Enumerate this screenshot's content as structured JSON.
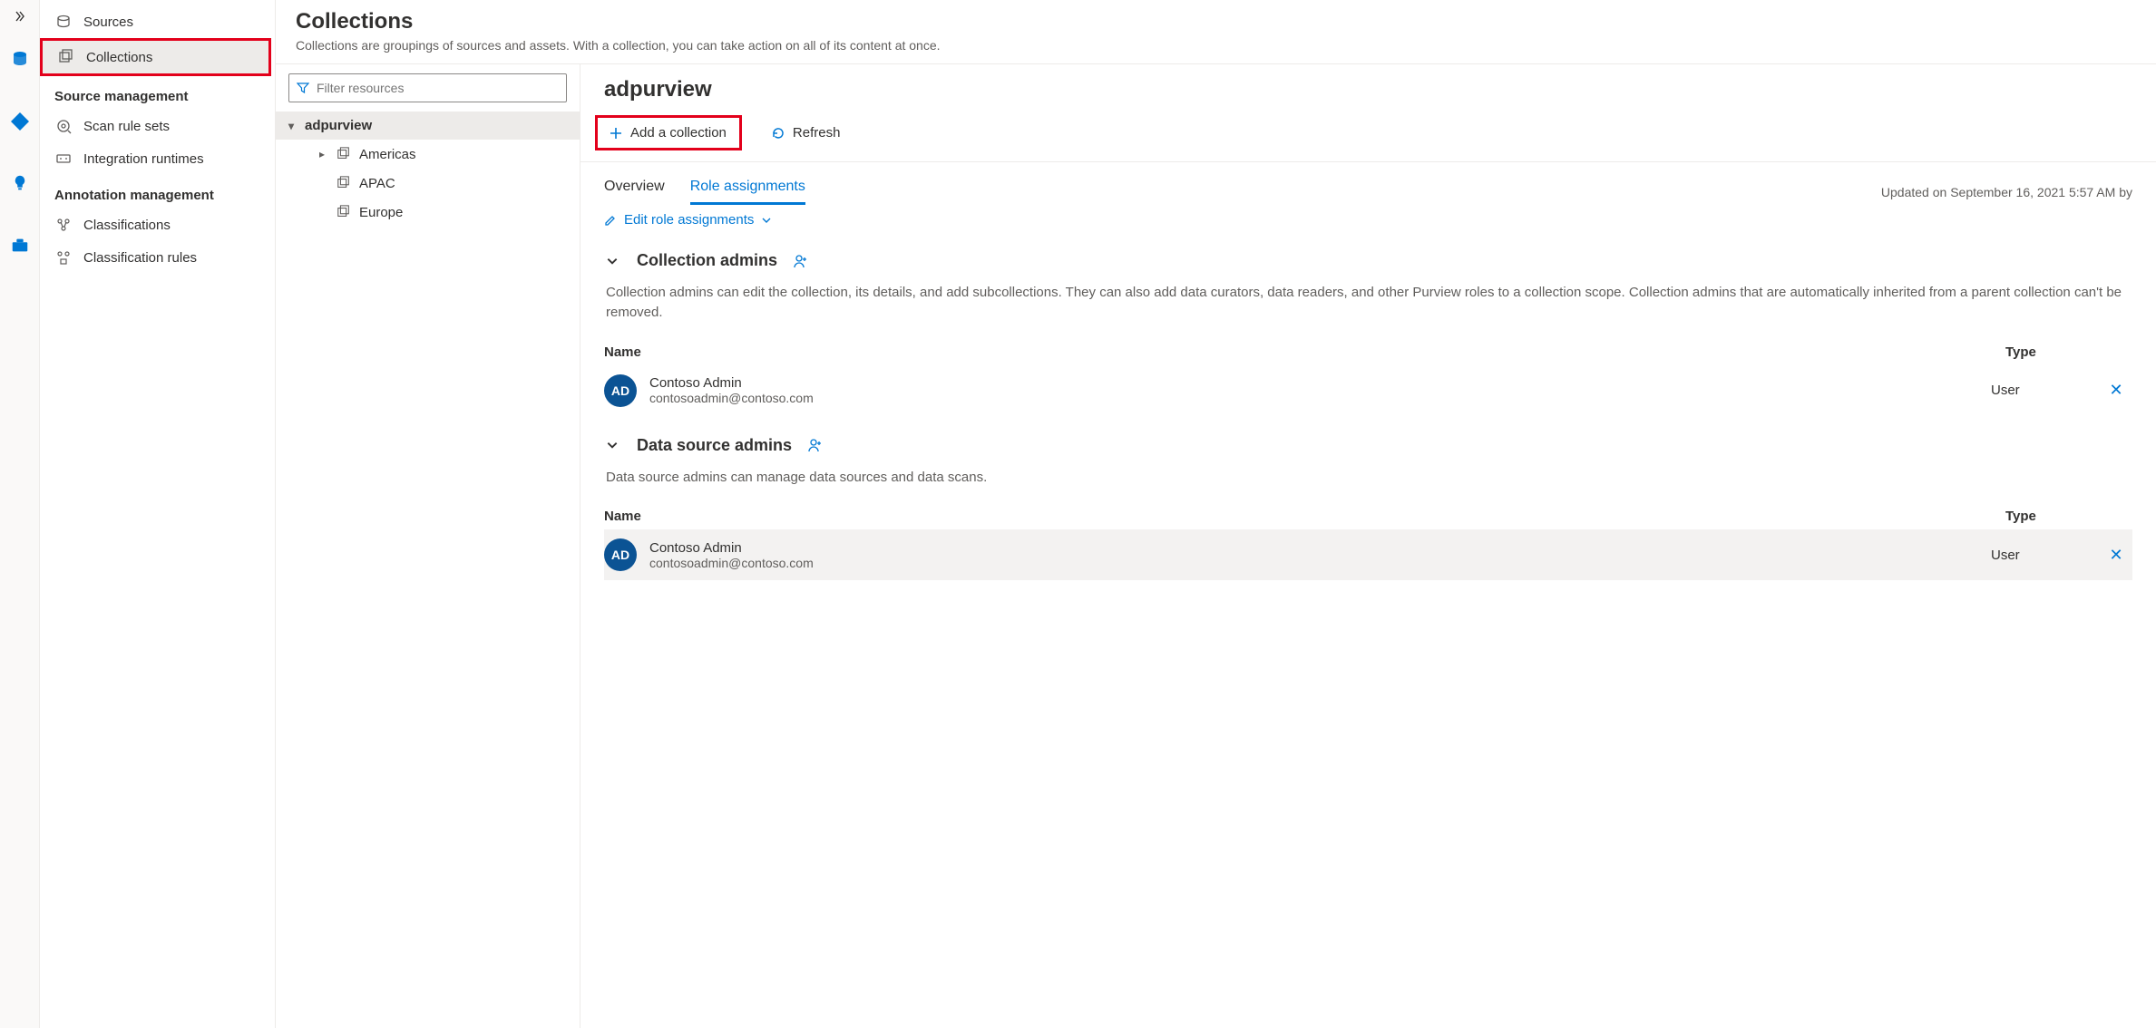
{
  "rail": {
    "icons": [
      "database",
      "flow",
      "insight",
      "toolbox"
    ]
  },
  "leftnav": {
    "items": [
      {
        "icon": "sources",
        "label": "Sources"
      },
      {
        "icon": "collections",
        "label": "Collections"
      }
    ],
    "section1": "Source management",
    "sm_items": [
      {
        "icon": "scanrules",
        "label": "Scan rule sets"
      },
      {
        "icon": "runtimes",
        "label": "Integration runtimes"
      }
    ],
    "section2": "Annotation management",
    "am_items": [
      {
        "icon": "class",
        "label": "Classifications"
      },
      {
        "icon": "classrules",
        "label": "Classification rules"
      }
    ]
  },
  "page": {
    "title": "Collections",
    "subtitle": "Collections are groupings of sources and assets. With a collection, you can take action on all of its content at once."
  },
  "filter": {
    "placeholder": "Filter resources"
  },
  "tree": {
    "root": "adpurview",
    "children": [
      "Americas",
      "APAC",
      "Europe"
    ]
  },
  "detail": {
    "title": "adpurview",
    "addLabel": "Add a collection",
    "refreshLabel": "Refresh",
    "tabs": {
      "overview": "Overview",
      "role": "Role assignments"
    },
    "updated": "Updated on September 16, 2021 5:57 AM by",
    "editLabel": "Edit role assignments"
  },
  "roles": {
    "table_name": "Name",
    "table_type": "Type",
    "admins": {
      "title": "Collection admins",
      "desc": "Collection admins can edit the collection, its details, and add subcollections. They can also add data curators, data readers, and other Purview roles to a collection scope. Collection admins that are automatically inherited from a parent collection can't be removed.",
      "rows": [
        {
          "initials": "AD",
          "name": "Contoso Admin",
          "email": "contosoadmin@contoso.com",
          "type": "User"
        }
      ]
    },
    "dsadmins": {
      "title": "Data source admins",
      "desc": "Data source admins can manage data sources and data scans.",
      "rows": [
        {
          "initials": "AD",
          "name": "Contoso Admin",
          "email": "contosoadmin@contoso.com",
          "type": "User"
        }
      ]
    }
  }
}
